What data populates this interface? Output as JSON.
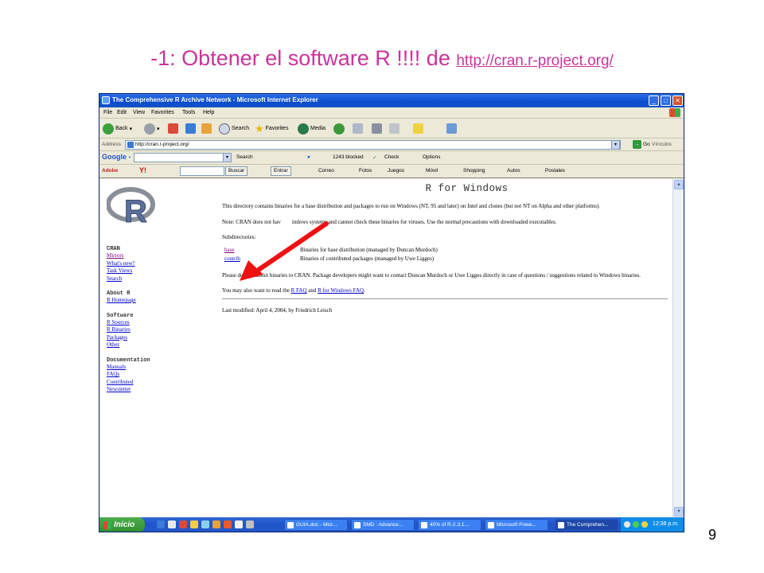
{
  "slide": {
    "title_prefix": "-1: Obtener el software R !!!! de",
    "title_link": "http://cran.r-project.org/",
    "page_number": "9"
  },
  "browser": {
    "window_title": "The Comprehensive R Archive Network - Microsoft Internet Explorer",
    "menu": [
      "File",
      "Edit",
      "View",
      "Favorites",
      "Tools",
      "Help"
    ],
    "toolbar": {
      "back": "Back",
      "search": "Search",
      "favorites": "Favorites",
      "media": "Media"
    },
    "address_label": "Address",
    "address_value": "http://cran.r-project.org/",
    "go_label": "Go",
    "links_label": "Vínculos",
    "google_bar": {
      "logo": "Google -",
      "search_label": "Search",
      "blocked": "1243 blocked",
      "check": "Check",
      "options": "Options"
    },
    "yahoo_bar": {
      "adobe": "Adobe",
      "yahoo": "Y!",
      "buscar": "Buscar",
      "entrar": "Entrar",
      "correo": "Correo",
      "fotos": "Fotos",
      "juegos": "Juegos",
      "movil": "Móvil",
      "shopping": "Shopping",
      "autos": "Autos",
      "postales": "Postales"
    }
  },
  "page": {
    "title": "R for Windows",
    "para1": "This directory contains binaries for a base distribution and packages to run on Windows (NT, 95 and later) on Intel and clones (but not NT on Alpha and other platforms).",
    "para2_start": "Note: CRAN does not hav",
    "para2_end": "indows systems and cannot check these binaries for viruses. Use the normal precautions with downloaded executables.",
    "subdirs_label": "Subdirectories:",
    "subdirs": [
      {
        "name": "base",
        "desc": "Binaries for base distribution (managed by Duncan Murdoch)"
      },
      {
        "name": "contrib",
        "desc": "Binaries of contributed packages (managed by Uwe Ligges)"
      }
    ],
    "para3": "Please do not submit binaries to CRAN. Package developers might want to contact Duncan Murdoch or Uwe Ligges directly in case of questions / suggestions related to Windows binaries.",
    "para4_start": "You may also want to read the",
    "rfaq": "R FAQ",
    "and": "and",
    "rwinfaq": "R for Windows FAQ",
    "last_modified": "Last modified: April 4, 2004, by Friedrich Leisch"
  },
  "sidebar": {
    "sections": [
      {
        "heading": "CRAN",
        "links": [
          "Mirrors",
          "What's new?",
          "Task Views",
          "Search"
        ]
      },
      {
        "heading": "About R",
        "links": [
          "R Homepage"
        ]
      },
      {
        "heading": "Software",
        "links": [
          "R Sources",
          "R Binaries",
          "Packages",
          "Other"
        ]
      },
      {
        "heading": "Documentation",
        "links": [
          "Manuals",
          "FAQs",
          "Contributed",
          "Newsletter"
        ]
      }
    ]
  },
  "taskbar": {
    "start": "Inicio",
    "tasks": [
      "GUIA.doc - Micr...",
      "SMD : Advance...",
      "40% of R-2.3.1....",
      "Microsoft Powe...",
      "The Comprehen..."
    ],
    "clock": "12:38 p.m."
  },
  "colors": {
    "title": "#cc3399",
    "arrow": "#ee1111",
    "link": "#0000cc",
    "visited": "#800080"
  }
}
